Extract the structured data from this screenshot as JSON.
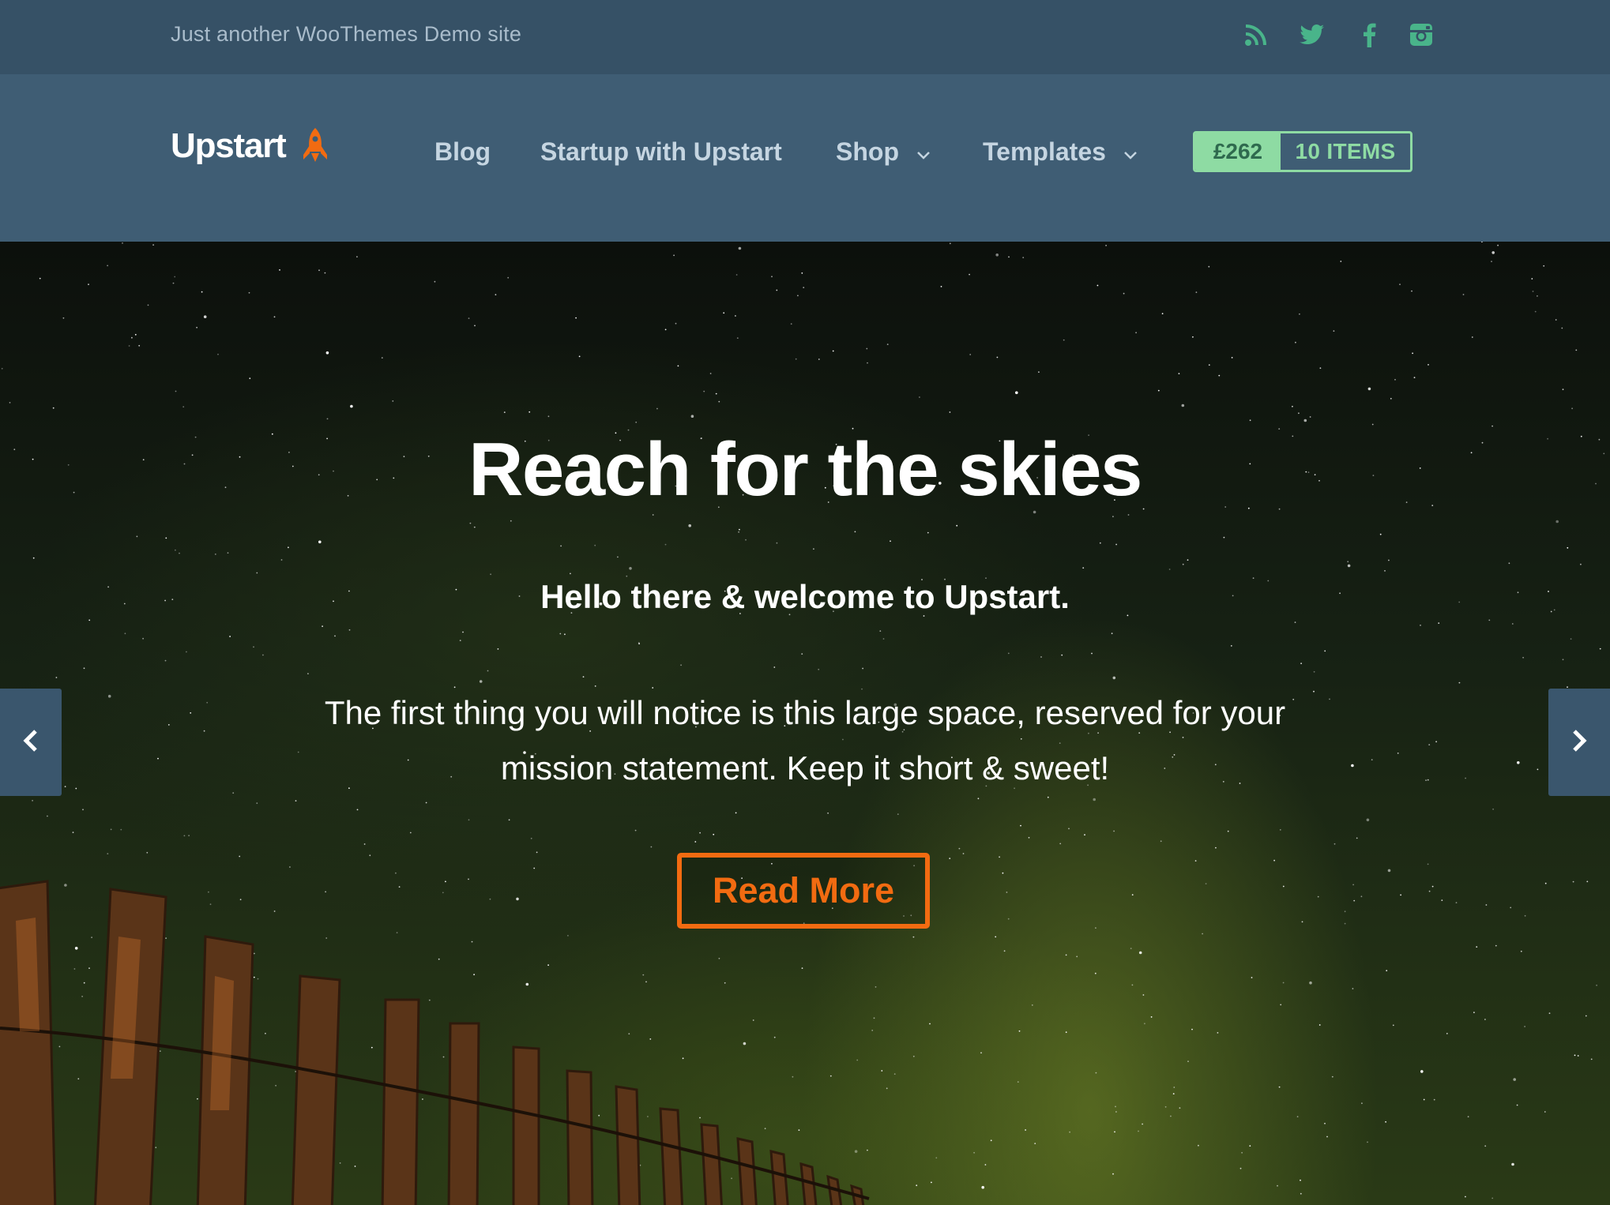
{
  "topbar": {
    "tagline": "Just another WooThemes Demo site",
    "social_icons": [
      "rss-icon",
      "twitter-icon",
      "facebook-icon",
      "instagram-icon"
    ],
    "icon_color": "#49b48a"
  },
  "header": {
    "logo_text": "Upstart",
    "logo_icon": "rocket-icon",
    "nav": [
      {
        "label": "Blog",
        "has_dropdown": false
      },
      {
        "label": "Startup with Upstart",
        "has_dropdown": false
      },
      {
        "label": "Shop",
        "has_dropdown": true
      },
      {
        "label": "Templates",
        "has_dropdown": true
      }
    ],
    "cart": {
      "amount": "£262",
      "items": "10 ITEMS"
    }
  },
  "hero": {
    "title": "Reach for the skies",
    "subtitle": "Hello there & welcome to Upstart.",
    "body": "The first thing you will notice is this large space, reserved for your mission statement. Keep it short & sweet!",
    "cta": "Read More",
    "prev_icon": "chevron-left-icon",
    "next_icon": "chevron-right-icon"
  },
  "colors": {
    "topbar_bg": "#365166",
    "header_bg": "#3f5d74",
    "accent": "#f26b11",
    "cart_green": "#8edba3"
  }
}
